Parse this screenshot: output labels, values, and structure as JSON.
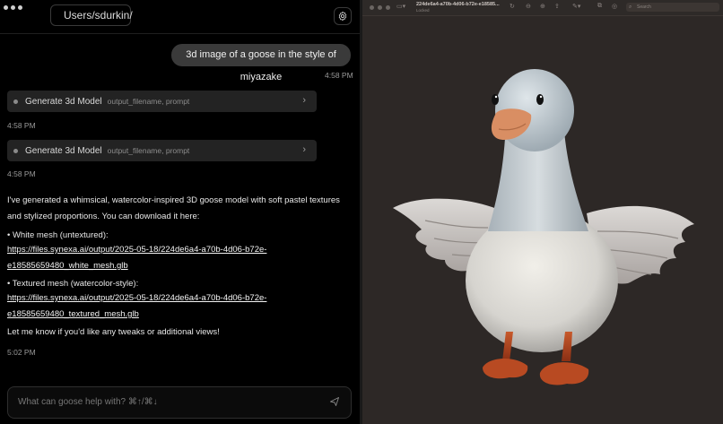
{
  "left": {
    "path": "Users/sdurkin/",
    "messages": {
      "user_prompt": "3d image of a goose in the style of miyazake",
      "user_time": "4:58 PM",
      "tools": [
        {
          "name": "Generate 3d Model",
          "args": "output_filename, prompt",
          "time": "4:58 PM"
        },
        {
          "name": "Generate 3d Model",
          "args": "output_filename, prompt",
          "time": "4:58 PM"
        }
      ],
      "reply": {
        "intro": "I've generated a whimsical, watercolor-inspired 3D goose model with soft pastel textures and stylized proportions. You can download it here:",
        "white_label": "• White mesh (untextured):",
        "white_link_1": "https://files.synexa.ai/output/2025-05-18/224de6a4-a70b-4d06-b72e-",
        "white_link_2": "e18585659480_white_mesh.glb",
        "textured_label": "• Textured mesh (watercolor-style):",
        "textured_link_1": "https://files.synexa.ai/output/2025-05-18/224de6a4-a70b-4d06-b72e-",
        "textured_link_2": "e18585659480_textured_mesh.glb",
        "outro": "Let me know if you'd like any tweaks or additional views!",
        "time": "5:02 PM"
      }
    },
    "composer_placeholder": "What can goose help with?  ⌘↑/⌘↓"
  },
  "right": {
    "file_title": "224de6a4-a70b-4d06-b72e-e18585...",
    "file_subtitle": "Locked",
    "search_placeholder": "Search"
  },
  "colors": {
    "chat_bg": "#000000",
    "bubble": "#3a3a3a",
    "tool_bg": "#232323",
    "preview_bg": "#2d2826"
  }
}
